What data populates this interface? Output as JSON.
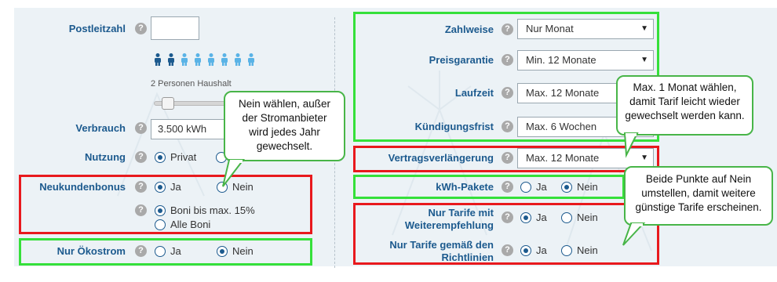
{
  "left": {
    "postleitzahl": {
      "label": "Postleitzahl",
      "value": ""
    },
    "household": {
      "caption": "2 Personen Haushalt",
      "total": 8,
      "selected": 2
    },
    "verbrauch": {
      "label": "Verbrauch",
      "value": "3.500 kWh"
    },
    "nutzung": {
      "label": "Nutzung",
      "opt1": "Privat"
    },
    "neukundenbonus": {
      "label": "Neukundenbonus",
      "opt1": "Ja",
      "opt2": "Nein",
      "sub1": "Boni bis max. 15%",
      "sub2": "Alle Boni"
    },
    "oekostrom": {
      "label": "Nur Ökostrom",
      "opt1": "Ja",
      "opt2": "Nein"
    }
  },
  "right": {
    "zahlweise": {
      "label": "Zahlweise",
      "value": "Nur Monat"
    },
    "preisgarantie": {
      "label": "Preisgarantie",
      "value": "Min. 12 Monate"
    },
    "laufzeit": {
      "label": "Laufzeit",
      "value": "Max. 12 Monate"
    },
    "kuendigungsfrist": {
      "label": "Kündigungsfrist",
      "value": "Max. 6 Wochen"
    },
    "vertragsverlaengerung": {
      "label": "Vertragsverlängerung",
      "value": "Max. 12 Monate"
    },
    "kwh_pakete": {
      "label": "kWh-Pakete",
      "opt1": "Ja",
      "opt2": "Nein"
    },
    "empfehlung": {
      "label_line1": "Nur Tarife mit",
      "label_line2": "Weiterempfehlung",
      "opt1": "Ja",
      "opt2": "Nein"
    },
    "richtlinien": {
      "label_line1": "Nur Tarife gemäß den",
      "label_line2": "Richtlinien",
      "opt1": "Ja",
      "opt2": "Nein"
    }
  },
  "icons": {
    "help": "help-icon",
    "arrow": "chevron-down-icon",
    "person": "person-icon"
  },
  "help_glyph": "?",
  "arrow_glyph": "▼",
  "callouts": {
    "c1": [
      "Nein wählen, außer",
      "der Stromanbieter",
      "wird jedes Jahr",
      "gewechselt."
    ],
    "c2": [
      "Max. 1 Monat wählen,",
      "damit Tarif leicht wieder",
      "gewechselt werden kann."
    ],
    "c3": [
      "Beide Punkte auf Nein",
      "umstellen, damit weitere",
      "günstige Tarife erscheinen."
    ]
  },
  "colors": {
    "label": "#1c5a8e",
    "red": "#e8191d",
    "green": "#35e03a",
    "person_dark": "#1c5a8e",
    "person_light": "#5ab3e6"
  }
}
